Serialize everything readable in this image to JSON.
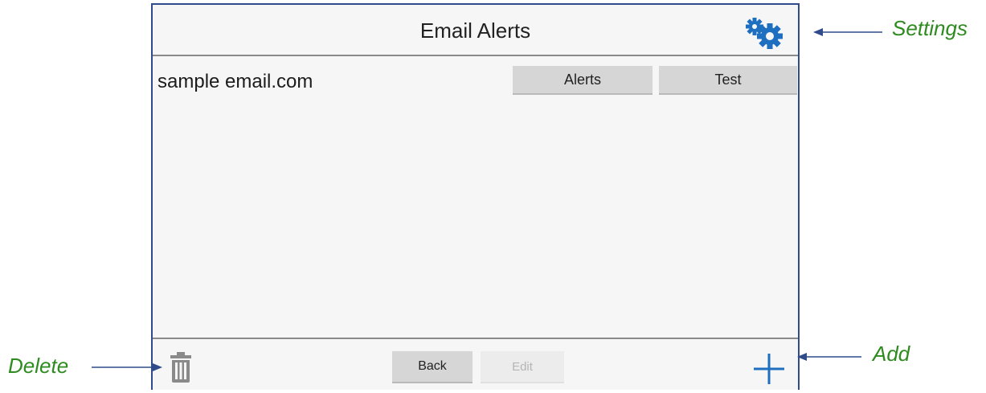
{
  "header": {
    "title": "Email Alerts",
    "settings_icon": "gears-icon"
  },
  "list": {
    "items": [
      {
        "email": "sample email.com",
        "alerts_label": "Alerts",
        "test_label": "Test"
      }
    ]
  },
  "footer": {
    "back_label": "Back",
    "edit_label": "Edit",
    "delete_icon": "trash-icon",
    "add_icon": "plus-icon"
  },
  "callouts": {
    "settings": "Settings",
    "add": "Add",
    "delete": "Delete"
  },
  "colors": {
    "frame": "#2f4b8a",
    "icon_blue": "#1f6fc0",
    "callout_green": "#2e8b1f",
    "button_gray": "#d6d6d6"
  }
}
